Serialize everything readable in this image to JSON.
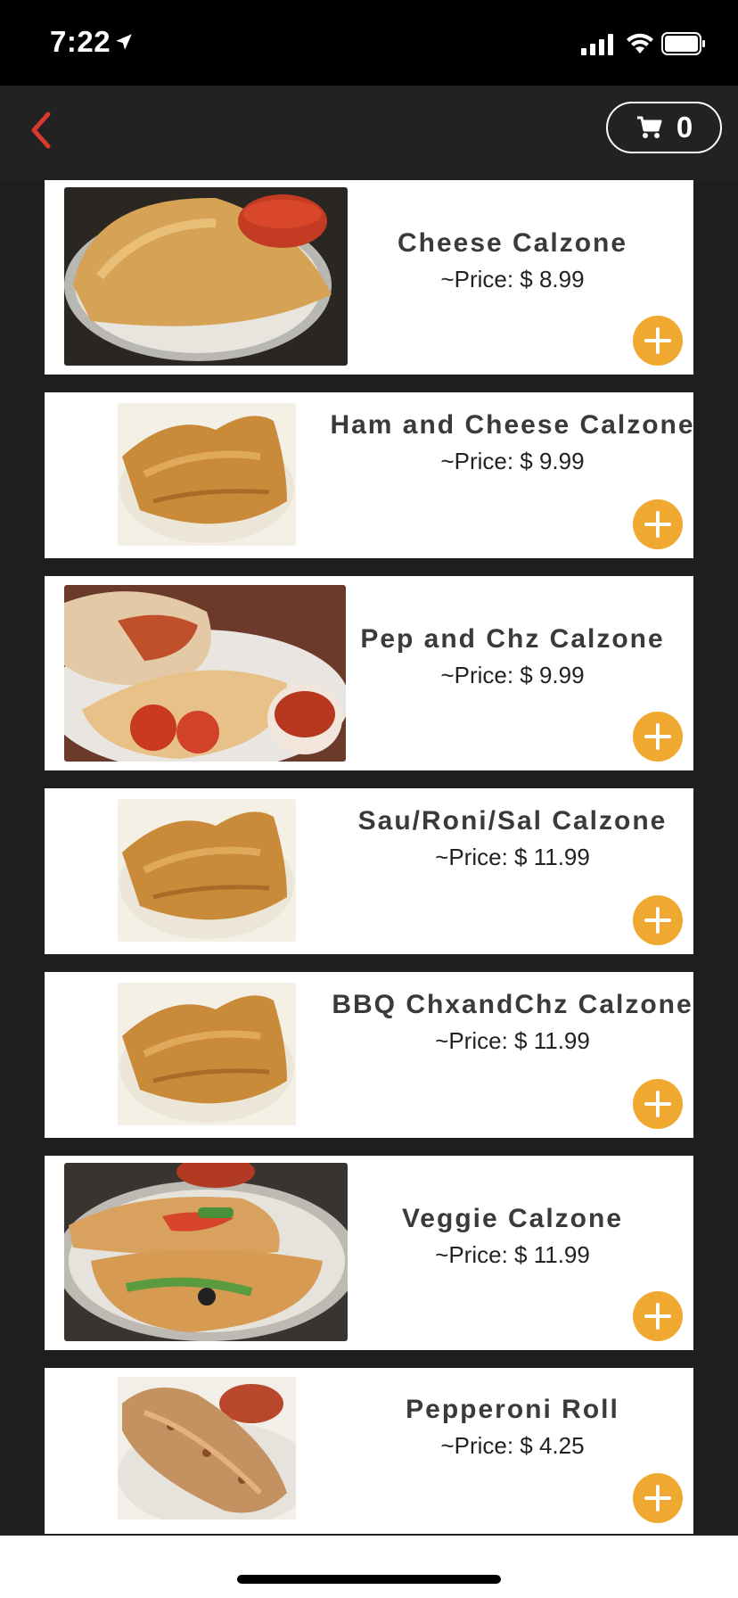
{
  "status": {
    "time": "7:22"
  },
  "nav": {
    "cart_count": "0"
  },
  "items": [
    {
      "name": "Cheese Calzone",
      "price": "~Price: $ 8.99"
    },
    {
      "name": "Ham and Cheese Calzone",
      "price": "~Price: $ 9.99"
    },
    {
      "name": "Pep and Chz Calzone",
      "price": "~Price: $ 9.99"
    },
    {
      "name": "Sau/Roni/Sal Calzone",
      "price": "~Price: $ 11.99"
    },
    {
      "name": "BBQ ChxandChz Calzone",
      "price": "~Price: $ 11.99"
    },
    {
      "name": "Veggie Calzone",
      "price": "~Price: $ 11.99"
    },
    {
      "name": "Pepperoni Roll",
      "price": "~Price: $ 4.25"
    }
  ],
  "colors": {
    "accent": "#f0a930",
    "back_arrow": "#d93a2b",
    "background": "#1e1e1e"
  },
  "icons": {
    "back": "chevron-left-icon",
    "cart": "cart-icon",
    "add": "plus-icon"
  }
}
